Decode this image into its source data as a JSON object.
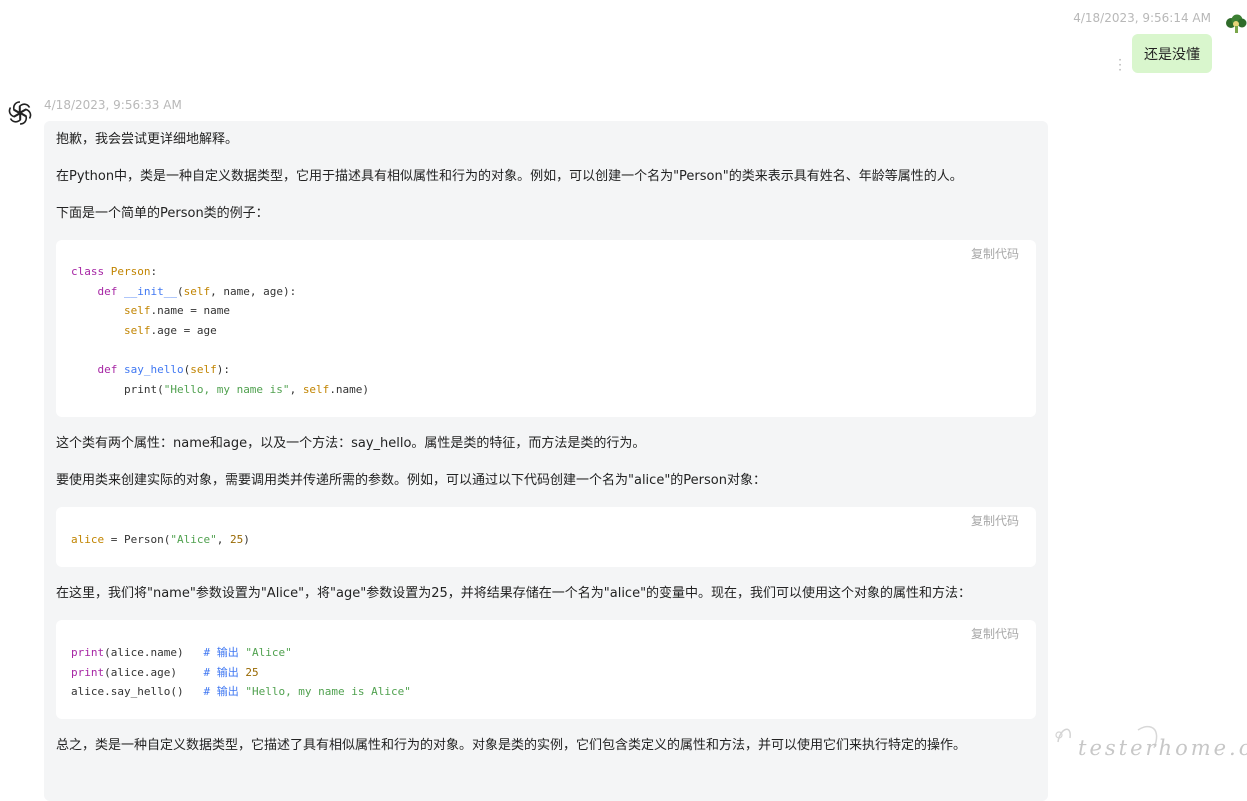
{
  "user_message": {
    "timestamp": "4/18/2023, 9:56:14 AM",
    "text": "还是没懂"
  },
  "assistant_message": {
    "timestamp": "4/18/2023, 9:56:33 AM",
    "paragraphs": [
      "抱歉，我会尝试更详细地解释。",
      "在Python中，类是一种自定义数据类型，它用于描述具有相似属性和行为的对象。例如，可以创建一个名为\"Person\"的类来表示具有姓名、年龄等属性的人。",
      "下面是一个简单的Person类的例子：",
      "这个类有两个属性：name和age，以及一个方法：say_hello。属性是类的特征，而方法是类的行为。",
      "要使用类来创建实际的对象，需要调用类并传递所需的参数。例如，可以通过以下代码创建一个名为\"alice\"的Person对象：",
      "在这里，我们将\"name\"参数设置为\"Alice\"，将\"age\"参数设置为25，并将结果存储在一个名为\"alice\"的变量中。现在，我们可以使用这个对象的属性和方法：",
      "总之，类是一种自定义数据类型，它描述了具有相似属性和行为的对象。对象是类的实例，它们包含类定义的属性和方法，并可以使用它们来执行特定的操作。"
    ],
    "copy_label": "复制代码",
    "code_blocks": [
      "class Person:\n    def __init__(self, name, age):\n        self.name = name\n        self.age = age\n\n    def say_hello(self):\n        print(\"Hello, my name is\", self.name)",
      "alice = Person(\"Alice\", 25)",
      "print(alice.name)   # 输出 \"Alice\"\nprint(alice.age)    # 输出 25\nalice.say_hello()   # 输出 \"Hello, my name is Alice\""
    ]
  },
  "watermark": {
    "text": "testerhome.com"
  },
  "icons": {
    "user_avatar": "broccoli-avatar-icon",
    "assistant_avatar": "openai-logo-icon",
    "more": "vertical-dots-icon"
  },
  "colors": {
    "user_bubble": "#d9f6cd",
    "assistant_bubble": "#f4f5f6",
    "code_background": "#ffffff"
  }
}
